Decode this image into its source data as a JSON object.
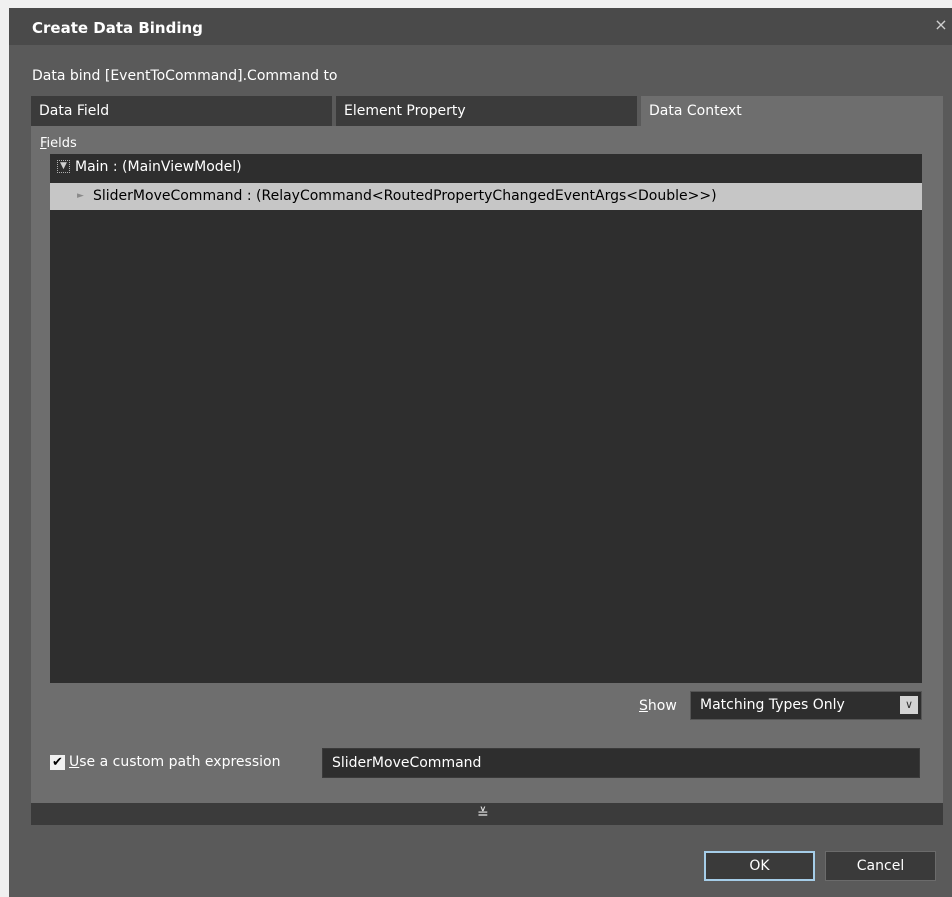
{
  "window": {
    "title": "Create Data Binding",
    "close_glyph": "×",
    "caption": "Data bind [EventToCommand].Command to"
  },
  "tabs": [
    {
      "label": "Data Field",
      "active": false
    },
    {
      "label": "Element Property",
      "active": false
    },
    {
      "label": "Data Context",
      "active": true
    }
  ],
  "fields": {
    "label_accel": "F",
    "label_rest": "ields",
    "tree": {
      "root": {
        "expander": "▼",
        "label": "Main : (MainViewModel)"
      },
      "child": {
        "arrow": "►",
        "label": "SliderMoveCommand : (RelayCommand<RoutedPropertyChangedEventArgs<Double>>)",
        "selected": true
      }
    }
  },
  "show": {
    "label_accel": "S",
    "label_rest": "how",
    "selected": "Matching Types Only",
    "arrow_icon": "chevron-down-icon"
  },
  "custom_path": {
    "checked": true,
    "check_glyph": "✔",
    "label_accel": "U",
    "label_rest": "se a custom path expression",
    "value": "SliderMoveCommand"
  },
  "expand_bar": {
    "icon": "double-chevron-down-icon",
    "glyph": "≚"
  },
  "buttons": {
    "ok": "OK",
    "cancel": "Cancel"
  }
}
